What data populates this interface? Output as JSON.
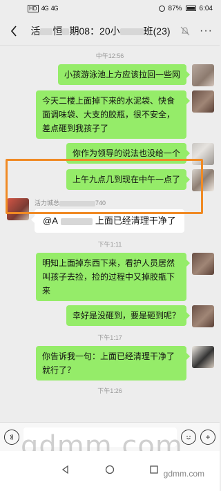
{
  "status": {
    "network": "HD",
    "signal1": "4G",
    "signal2": "4G",
    "battery": "87%",
    "time": "6:04"
  },
  "header": {
    "title_prefix": "活",
    "title_middle": "恒",
    "title_suffix": "期08：20小",
    "title_end": "班(23)",
    "back_icon": "chevron-left-icon",
    "mute_icon": "mute-bell-icon",
    "more_icon": "more-icon"
  },
  "chat": {
    "time_1": "中午12:56",
    "messages_top": [
      "小孩游泳池上方应该拉回一些网",
      "今天二楼上面掉下来的水泥袋、快食面调味袋、大支的胶瓶，很不安全，差点砸到我孩子了",
      "你作为领导的说法也没给一个",
      "上午九点几到现在中午一点了"
    ],
    "reply_sender_prefix": "活力城总",
    "reply_sender_suffix": "740",
    "reply_text_prefix": "@A",
    "reply_text_suffix": "上面已经清理干净了",
    "time_2": "下午1:11",
    "messages_mid": [
      "明知上面掉东西下来，看护人员居然叫孩子去捡，捡的过程中又掉胶瓶下来",
      "幸好是没砸到，要是砸到呢？"
    ],
    "time_3": "下午1:17",
    "messages_bottom": [
      "你告诉我一句：上面已经清理干净了　就行了？"
    ],
    "time_4": "下午1:26"
  },
  "input": {
    "voice_icon": "voice-icon",
    "emoji_icon": "emoji-icon",
    "add_icon": "add-icon"
  },
  "watermark": {
    "main": "gdmm.com",
    "small": "gdmm.com"
  },
  "colors": {
    "bubble_green": "#95ec69",
    "highlight": "#f08a24",
    "background": "#ededed"
  }
}
